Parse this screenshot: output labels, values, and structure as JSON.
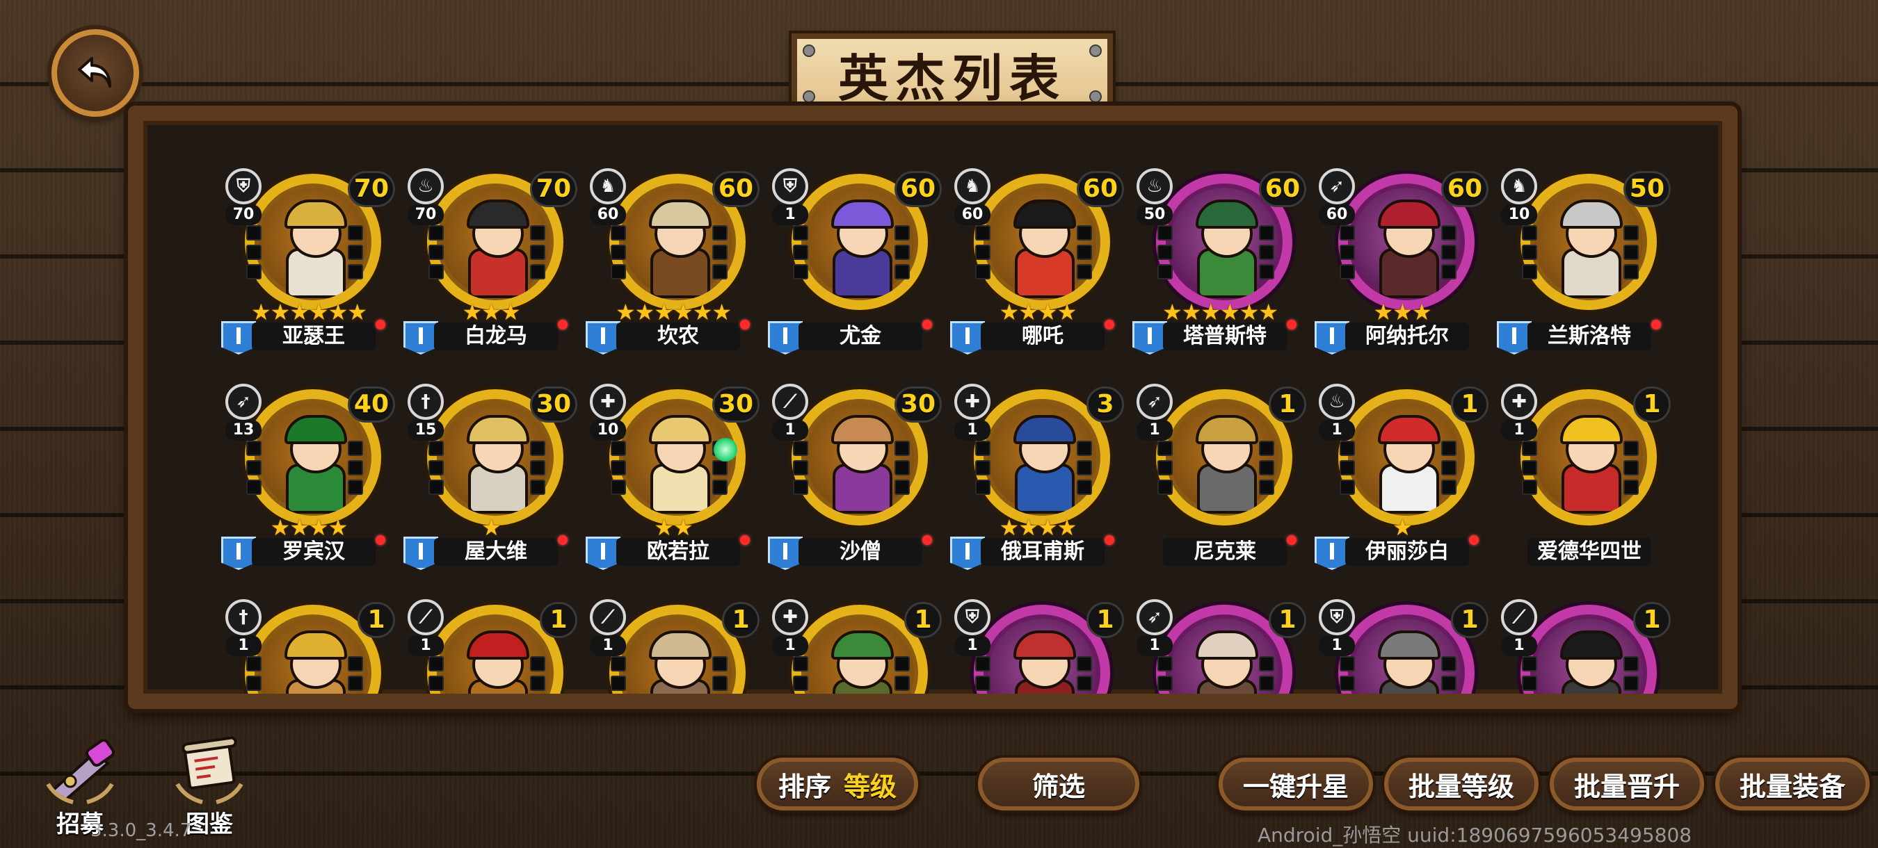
{
  "header": {
    "title": "英杰列表",
    "back_icon": "back-arrow-icon"
  },
  "heroes": [
    {
      "name": "亚瑟王",
      "class_icon": "shield-icon",
      "class_glyph": "⛨",
      "class_level": "70",
      "level": "70",
      "stars": "★★★★★★",
      "rank_flag": true,
      "red_dot": true,
      "frame": "gold",
      "hair": "#e8c16a",
      "body": "#e8e0d0",
      "hat": "#d8b040"
    },
    {
      "name": "白龙马",
      "class_icon": "flame-icon",
      "class_glyph": "♨",
      "class_level": "70",
      "level": "70",
      "stars": "★★★",
      "rank_flag": true,
      "red_dot": true,
      "frame": "gold",
      "hair": "#222",
      "body": "#c8302a",
      "hat": "#2a2a2a"
    },
    {
      "name": "坎农",
      "class_icon": "horse-icon",
      "class_glyph": "♞",
      "class_level": "60",
      "level": "60",
      "stars": "★★★★★★",
      "rank_flag": true,
      "red_dot": true,
      "frame": "gold",
      "hair": "#b07040",
      "body": "#7a4a20",
      "hat": "#d8c8a0"
    },
    {
      "name": "尤金",
      "class_icon": "shield-icon",
      "class_glyph": "⛨",
      "class_level": "1",
      "level": "60",
      "stars": "",
      "rank_flag": true,
      "red_dot": true,
      "frame": "gold",
      "hair": "#6a4ac8",
      "body": "#4a3a9a",
      "hat": "#7a5ad8"
    },
    {
      "name": "哪吒",
      "class_icon": "horse-icon",
      "class_glyph": "♞",
      "class_level": "60",
      "level": "60",
      "stars": "★★★★",
      "rank_flag": true,
      "red_dot": true,
      "frame": "gold",
      "hair": "#1a1a1a",
      "body": "#d83a2a",
      "hat": "#1a1a1a"
    },
    {
      "name": "塔普斯特",
      "class_icon": "flame-icon",
      "class_glyph": "♨",
      "class_level": "50",
      "level": "60",
      "stars": "★★★★★★",
      "rank_flag": true,
      "red_dot": true,
      "frame": "purple",
      "hair": "#8ad0a0",
      "body": "#3a8a3a",
      "hat": "#2a6a3a"
    },
    {
      "name": "阿纳托尔",
      "class_icon": "bow-icon",
      "class_glyph": "➶",
      "class_level": "60",
      "level": "60",
      "stars": "★★★",
      "rank_flag": true,
      "red_dot": false,
      "frame": "purple",
      "hair": "#a02030",
      "body": "#5a2a2a",
      "hat": "#b02030"
    },
    {
      "name": "兰斯洛特",
      "class_icon": "horse-icon",
      "class_glyph": "♞",
      "class_level": "10",
      "level": "50",
      "stars": "",
      "rank_flag": true,
      "red_dot": true,
      "frame": "gold",
      "hair": "#d8d8d8",
      "body": "#e0d8c8",
      "hat": "#c8c8c8"
    },
    {
      "name": "罗宾汉",
      "class_icon": "bow-icon",
      "class_glyph": "➶",
      "class_level": "13",
      "level": "40",
      "stars": "★★★★",
      "rank_flag": true,
      "red_dot": true,
      "frame": "gold",
      "hair": "#2a8a3a",
      "body": "#2a8a3a",
      "hat": "#1a7a2a"
    },
    {
      "name": "屋大维",
      "class_icon": "sword-icon",
      "class_glyph": "†",
      "class_level": "15",
      "level": "30",
      "stars": "★",
      "rank_flag": true,
      "red_dot": true,
      "frame": "gold",
      "hair": "#e8e8e8",
      "body": "#d8d0c0",
      "hat": "#e0c060"
    },
    {
      "name": "欧若拉",
      "class_icon": "cross-icon",
      "class_glyph": "✚",
      "class_level": "10",
      "level": "30",
      "stars": "★★",
      "rank_flag": true,
      "red_dot": true,
      "frame": "gold",
      "hair": "#f0d080",
      "body": "#f0e0b0",
      "hat": "#e8c870",
      "orb": true
    },
    {
      "name": "沙僧",
      "class_icon": "spear-icon",
      "class_glyph": "⟋",
      "class_level": "1",
      "level": "30",
      "stars": "",
      "rank_flag": true,
      "red_dot": true,
      "frame": "gold",
      "hair": "#3a2a1a",
      "body": "#8a3a9a",
      "hat": "#c88a50"
    },
    {
      "name": "俄耳甫斯",
      "class_icon": "cross-icon",
      "class_glyph": "✚",
      "class_level": "1",
      "level": "3",
      "stars": "★★★★",
      "rank_flag": true,
      "red_dot": true,
      "frame": "gold",
      "hair": "#1a1a1a",
      "body": "#2a5ab0",
      "hat": "#2a4a9a"
    },
    {
      "name": "尼克莱",
      "class_icon": "bow-icon",
      "class_glyph": "➶",
      "class_level": "1",
      "level": "1",
      "stars": "",
      "rank_flag": false,
      "red_dot": true,
      "frame": "gold",
      "hair": "#5a5a5a",
      "body": "#6a6a6a",
      "hat": "#c8a040"
    },
    {
      "name": "伊丽莎白",
      "class_icon": "flame-icon",
      "class_glyph": "♨",
      "class_level": "1",
      "level": "1",
      "stars": "★",
      "rank_flag": true,
      "red_dot": true,
      "frame": "gold",
      "hair": "#e87a30",
      "body": "#f0f0f0",
      "hat": "#d02a2a"
    },
    {
      "name": "爱德华四世",
      "class_icon": "cross-icon",
      "class_glyph": "✚",
      "class_level": "1",
      "level": "1",
      "stars": "",
      "rank_flag": false,
      "red_dot": false,
      "frame": "gold",
      "hair": "#f0e0c0",
      "body": "#c82a2a",
      "hat": "#f0c020"
    },
    {
      "name": "",
      "class_icon": "sword-icon",
      "class_glyph": "†",
      "class_level": "1",
      "level": "1",
      "stars": "",
      "rank_flag": false,
      "red_dot": false,
      "frame": "gold",
      "hair": "#e8c040",
      "body": "#c89040",
      "hat": "#e0b030"
    },
    {
      "name": "",
      "class_icon": "spear-icon",
      "class_glyph": "⟋",
      "class_level": "1",
      "level": "1",
      "stars": "",
      "rank_flag": false,
      "red_dot": false,
      "frame": "gold",
      "hair": "#c89030",
      "body": "#b07020",
      "hat": "#c02020"
    },
    {
      "name": "",
      "class_icon": "spear-icon",
      "class_glyph": "⟋",
      "class_level": "1",
      "level": "1",
      "stars": "",
      "rank_flag": false,
      "red_dot": false,
      "frame": "gold",
      "hair": "#5a3a20",
      "body": "#8a6a50",
      "hat": "#d0b890"
    },
    {
      "name": "",
      "class_icon": "cross-icon",
      "class_glyph": "✚",
      "class_level": "1",
      "level": "1",
      "stars": "",
      "rank_flag": false,
      "red_dot": false,
      "frame": "gold",
      "hair": "#1a1a1a",
      "body": "#5a6a2a",
      "hat": "#3a8a3a"
    },
    {
      "name": "",
      "class_icon": "shield-icon",
      "class_glyph": "⛨",
      "class_level": "1",
      "level": "1",
      "stars": "",
      "rank_flag": false,
      "red_dot": false,
      "frame": "purple",
      "hair": "#b02a2a",
      "body": "#8a2020",
      "hat": "#c03030"
    },
    {
      "name": "",
      "class_icon": "bow-icon",
      "class_glyph": "➶",
      "class_level": "1",
      "level": "1",
      "stars": "",
      "rank_flag": false,
      "red_dot": false,
      "frame": "purple",
      "hair": "#d8c8b0",
      "body": "#6a4a3a",
      "hat": "#e0d0c0"
    },
    {
      "name": "",
      "class_icon": "shield-icon",
      "class_glyph": "⛨",
      "class_level": "1",
      "level": "1",
      "stars": "",
      "rank_flag": false,
      "red_dot": false,
      "frame": "purple",
      "hair": "#5a5a5a",
      "body": "#4a4a4a",
      "hat": "#7a7a7a"
    },
    {
      "name": "",
      "class_icon": "spear-icon",
      "class_glyph": "⟋",
      "class_level": "1",
      "level": "1",
      "stars": "",
      "rank_flag": false,
      "red_dot": false,
      "frame": "purple",
      "hair": "#2a2a2a",
      "body": "#3a3a3a",
      "hat": "#1a1a1a"
    }
  ],
  "bottom_menu": {
    "recruit_label": "招募",
    "recruit_icon": "telescope-icon",
    "atlas_label": "图鉴",
    "atlas_icon": "scroll-icon",
    "sort_label": "排序",
    "sort_value": "等级",
    "filter_label": "筛选",
    "one_click_star_label": "一键升星",
    "batch_level_label": "批量等级",
    "batch_promote_label": "批量晋升",
    "batch_equip_label": "批量装备"
  },
  "footer": {
    "version": "3.3.0_3.4.7",
    "uuid_text": "Android_孙悟空 uuid:1890697596053495808"
  },
  "colors": {
    "accent_gold": "#ffd21a",
    "frame_gold": "#e5b21a",
    "frame_purple": "#c23aa8",
    "rank_blue": "#2f7fd6",
    "notify_red": "#ff2a2a"
  }
}
